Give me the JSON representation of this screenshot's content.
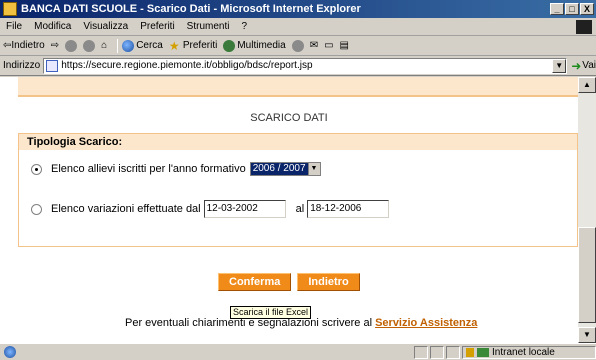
{
  "window": {
    "title": "BANCA DATI SCUOLE - Scarico Dati - Microsoft Internet Explorer",
    "minimize": "_",
    "maximize": "□",
    "close": "X"
  },
  "menu": [
    "File",
    "Modifica",
    "Visualizza",
    "Preferiti",
    "Strumenti",
    "?"
  ],
  "toolbar": {
    "back": "Indietro",
    "search": "Cerca",
    "favorites": "Preferiti",
    "multimedia": "Multimedia"
  },
  "address": {
    "label": "Indirizzo",
    "url": "https://secure.regione.piemonte.it/obbligo/bdsc/report.jsp",
    "go": "Vai"
  },
  "page": {
    "section_title": "SCARICO DATI",
    "tipologia_label": "Tipologia Scarico:",
    "option1_label": "Elenco allievi iscritti per l'anno formativo",
    "option1_year": "2006 / 2007",
    "option2_label": "Elenco variazioni effettuate dal",
    "date_from": "12-03-2002",
    "al_label": "al",
    "date_to": "18-12-2006",
    "confirm_button": "Conferma",
    "back_button": "Indietro",
    "tooltip": "Scarica il file Excel",
    "footer_text": "Per eventuali chiarimenti e segnalazioni scrivere al",
    "footer_link": "Servizio Assistenza"
  },
  "status": {
    "zone": "Intranet locale"
  }
}
